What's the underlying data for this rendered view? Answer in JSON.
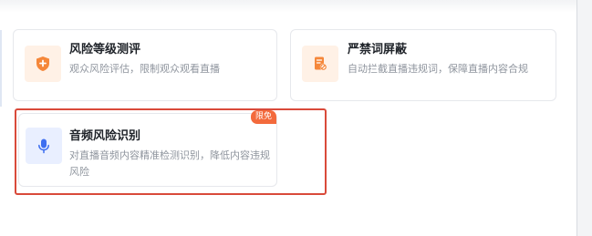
{
  "cards": [
    {
      "title": "风险等级测评",
      "description": "观众风险评估，限制观众观看直播",
      "icon": "shield-plus-icon"
    },
    {
      "title": "严禁词屏蔽",
      "description": "自动拦截直播违规词，保障直播内容合规",
      "icon": "document-block-icon"
    },
    {
      "title": "音频风险识别",
      "description": "对直播音频内容精准检测识别，降低内容违规风险",
      "icon": "microphone-icon",
      "badge": "限免",
      "highlighted": true
    }
  ],
  "colors": {
    "accent_orange": "#f5873a",
    "accent_blue": "#3d6ef0",
    "badge": "#f36a3c",
    "highlight_border": "#d94a3a"
  }
}
